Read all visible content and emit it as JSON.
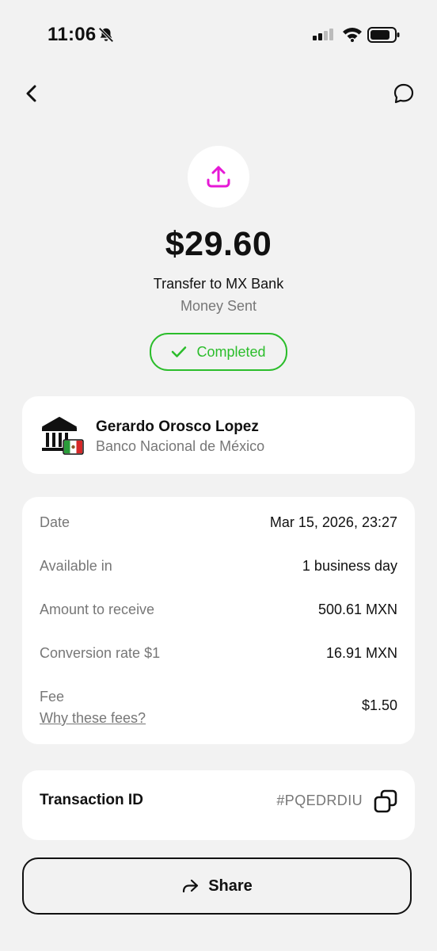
{
  "status_bar": {
    "time": "11:06"
  },
  "colors": {
    "accent_magenta": "#e619d6",
    "success_green": "#2bbd2b",
    "background": "#f2f2f2"
  },
  "header": {
    "back_icon": "chevron-left-icon",
    "chat_icon": "chat-bubble-icon"
  },
  "transaction": {
    "icon": "upload-icon",
    "amount": "$29.60",
    "subtitle": "Transfer to MX Bank",
    "kind": "Money Sent",
    "status": "Completed"
  },
  "recipient": {
    "name": "Gerardo Orosco Lopez",
    "bank": "Banco Nacional de México"
  },
  "details": {
    "rows": [
      {
        "label": "Date",
        "value": "Mar 15, 2026, 23:27"
      },
      {
        "label": "Available in",
        "value": "1 business day"
      },
      {
        "label": "Amount to receive",
        "value": "500.61 MXN"
      },
      {
        "label": "Conversion rate $1",
        "value": "16.91 MXN"
      }
    ],
    "fee_label": "Fee",
    "fee_link": "Why these fees?",
    "fee_value": "$1.50"
  },
  "transaction_id": {
    "label": "Transaction ID",
    "value": "#PQEDRDIU"
  },
  "share": {
    "label": "Share"
  }
}
